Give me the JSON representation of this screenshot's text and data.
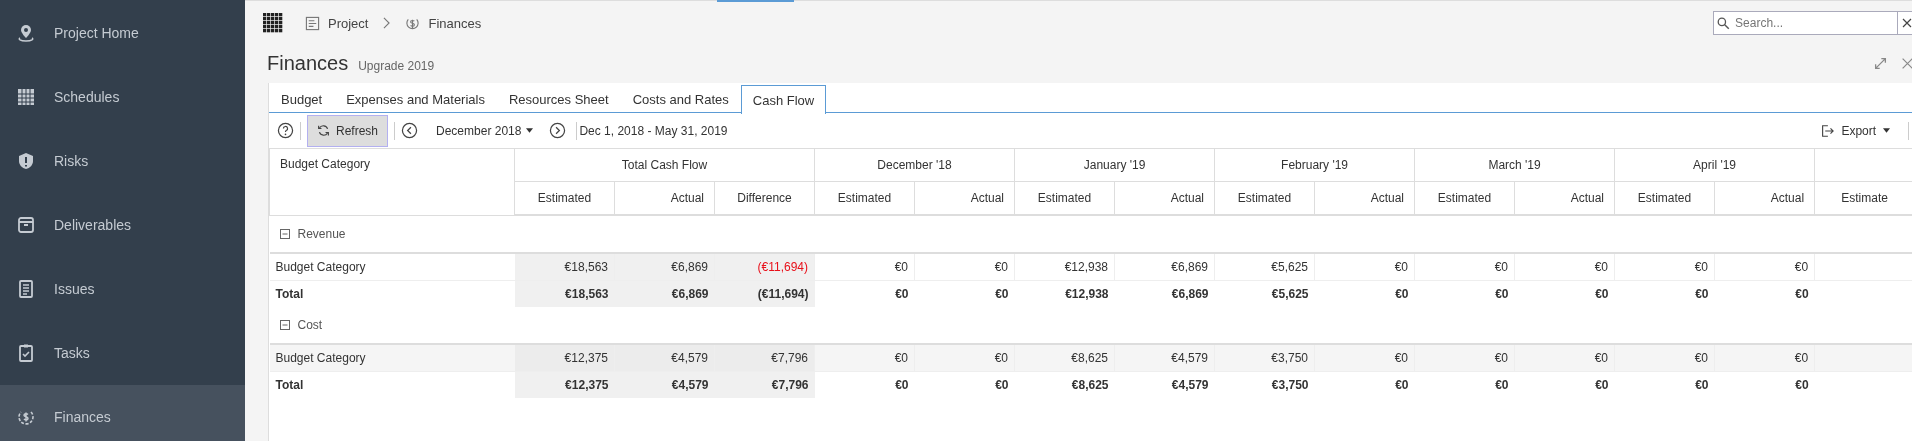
{
  "sidebar": {
    "items": [
      {
        "label": "Project Home",
        "selected": false
      },
      {
        "label": "Schedules",
        "selected": false
      },
      {
        "label": "Risks",
        "selected": false
      },
      {
        "label": "Deliverables",
        "selected": false
      },
      {
        "label": "Issues",
        "selected": false
      },
      {
        "label": "Tasks",
        "selected": false
      },
      {
        "label": "Finances",
        "selected": true
      }
    ]
  },
  "breadcrumb": [
    {
      "label": "Project"
    },
    {
      "label": "Finances"
    }
  ],
  "search": {
    "placeholder": "Search..."
  },
  "page": {
    "title": "Finances",
    "subtitle": "Upgrade 2019"
  },
  "tabs": [
    {
      "label": "Budget",
      "selected": false
    },
    {
      "label": "Expenses and Materials",
      "selected": false
    },
    {
      "label": "Resources Sheet",
      "selected": false
    },
    {
      "label": "Costs and Rates",
      "selected": false
    },
    {
      "label": "Cash Flow",
      "selected": true
    }
  ],
  "toolbar": {
    "refresh": "Refresh",
    "month": "December 2018",
    "date_range": "Dec 1, 2018 - May 31, 2019",
    "export": "Export"
  },
  "table": {
    "first_column": "Budget Category",
    "groups": [
      {
        "label": "Total Cash Flow",
        "shaded": true,
        "subcolumns": [
          "Estimated",
          "Actual",
          "Difference"
        ]
      },
      {
        "label": "December '18",
        "shaded": false,
        "subcolumns": [
          "Estimated",
          "Actual"
        ]
      },
      {
        "label": "January '19",
        "shaded": false,
        "subcolumns": [
          "Estimated",
          "Actual"
        ]
      },
      {
        "label": "February '19",
        "shaded": false,
        "subcolumns": [
          "Estimated",
          "Actual"
        ]
      },
      {
        "label": "March '19",
        "shaded": false,
        "subcolumns": [
          "Estimated",
          "Actual"
        ]
      },
      {
        "label": "April '19",
        "shaded": false,
        "subcolumns": [
          "Estimated",
          "Actual"
        ]
      },
      {
        "shaded": false,
        "subcolumns": [
          "Estimate"
        ]
      }
    ],
    "sections": [
      {
        "label": "Revenue",
        "expanded": true,
        "rows": [
          {
            "kind": "item",
            "label": "Budget Category",
            "selected": false,
            "cells": [
              {
                "text": "€18,563",
                "alert": false
              },
              {
                "text": "€6,869",
                "alert": false
              },
              {
                "text": "(€11,694)",
                "alert": true
              },
              {
                "text": "€0",
                "alert": false
              },
              {
                "text": "€0",
                "alert": false
              },
              {
                "text": "€12,938",
                "alert": false
              },
              {
                "text": "€6,869",
                "alert": false
              },
              {
                "text": "€5,625",
                "alert": false
              },
              {
                "text": "€0",
                "alert": false
              },
              {
                "text": "€0",
                "alert": false
              },
              {
                "text": "€0",
                "alert": false
              },
              {
                "text": "€0",
                "alert": false
              },
              {
                "text": "€0",
                "alert": false
              }
            ]
          },
          {
            "kind": "total",
            "label": "Total",
            "selected": false,
            "cells": [
              {
                "text": "€18,563",
                "alert": false
              },
              {
                "text": "€6,869",
                "alert": false
              },
              {
                "text": "(€11,694)",
                "alert": false
              },
              {
                "text": "€0",
                "alert": false
              },
              {
                "text": "€0",
                "alert": false
              },
              {
                "text": "€12,938",
                "alert": false
              },
              {
                "text": "€6,869",
                "alert": false
              },
              {
                "text": "€5,625",
                "alert": false
              },
              {
                "text": "€0",
                "alert": false
              },
              {
                "text": "€0",
                "alert": false
              },
              {
                "text": "€0",
                "alert": false
              },
              {
                "text": "€0",
                "alert": false
              },
              {
                "text": "€0",
                "alert": false
              }
            ]
          }
        ]
      },
      {
        "label": "Cost",
        "expanded": true,
        "rows": [
          {
            "kind": "item",
            "label": "Budget Category",
            "selected": true,
            "cells": [
              {
                "text": "€12,375",
                "alert": false
              },
              {
                "text": "€4,579",
                "alert": false
              },
              {
                "text": "€7,796",
                "alert": false
              },
              {
                "text": "€0",
                "alert": false
              },
              {
                "text": "€0",
                "alert": false
              },
              {
                "text": "€8,625",
                "alert": false
              },
              {
                "text": "€4,579",
                "alert": false
              },
              {
                "text": "€3,750",
                "alert": false
              },
              {
                "text": "€0",
                "alert": false
              },
              {
                "text": "€0",
                "alert": false
              },
              {
                "text": "€0",
                "alert": false
              },
              {
                "text": "€0",
                "alert": false
              },
              {
                "text": "€0",
                "alert": false
              }
            ]
          },
          {
            "kind": "total",
            "label": "Total",
            "selected": false,
            "cells": [
              {
                "text": "€12,375",
                "alert": false
              },
              {
                "text": "€4,579",
                "alert": false
              },
              {
                "text": "€7,796",
                "alert": false
              },
              {
                "text": "€0",
                "alert": false
              },
              {
                "text": "€0",
                "alert": false
              },
              {
                "text": "€8,625",
                "alert": false
              },
              {
                "text": "€4,579",
                "alert": false
              },
              {
                "text": "€3,750",
                "alert": false
              },
              {
                "text": "€0",
                "alert": false
              },
              {
                "text": "€0",
                "alert": false
              },
              {
                "text": "€0",
                "alert": false
              },
              {
                "text": "€0",
                "alert": false
              },
              {
                "text": "€0",
                "alert": false
              }
            ]
          }
        ]
      }
    ]
  }
}
